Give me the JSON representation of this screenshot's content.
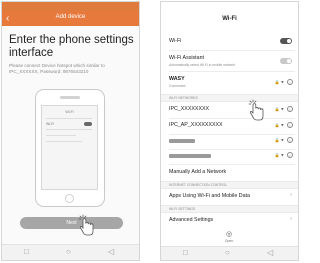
{
  "left": {
    "title": "Add device",
    "back_icon": "‹",
    "heading": "Enter the phone settings interface",
    "instruction": "Please connect Device hotspot which similar to IPC_XXXXXX, Password: 9876543210",
    "mock": {
      "title": "Wi-Fi",
      "row1": "Wi-Fi"
    },
    "next_label": "Next",
    "nav": {
      "back": "◁",
      "home": "○",
      "recent": "□"
    }
  },
  "right": {
    "title": "Wi-Fi",
    "wifi_label": "Wi-Fi",
    "assistant_label": "Wi-Fi Assistant",
    "assistant_sub": "Automatically select Wi-Fi in mobile network",
    "connected_name": "WASY",
    "connected_sub": "Connected",
    "section_networks": "WI-FI NETWORKS",
    "networks": [
      {
        "name": "IPC_XXXXXXXX"
      },
      {
        "name": "IPC_AP_XXXXXXXXX"
      },
      {
        "name": ""
      },
      {
        "name": ""
      }
    ],
    "manual_add": "Manually Add a Network",
    "section_internet": "INTERNET CONNECTION CONTROL",
    "apps_label": "Apps Using Wi-Fi and Mobile Data",
    "section_settings": "WI-FI SETTINGS",
    "advanced_label": "Advanced Settings",
    "open_label": "Open",
    "lock_icon": "🔒",
    "signal_icon": "▾",
    "info_icon": "i",
    "chevron_icon": "›",
    "nav": {
      "back": "◁",
      "home": "○",
      "recent": "□"
    }
  },
  "colors": {
    "accent": "#e8793d"
  }
}
